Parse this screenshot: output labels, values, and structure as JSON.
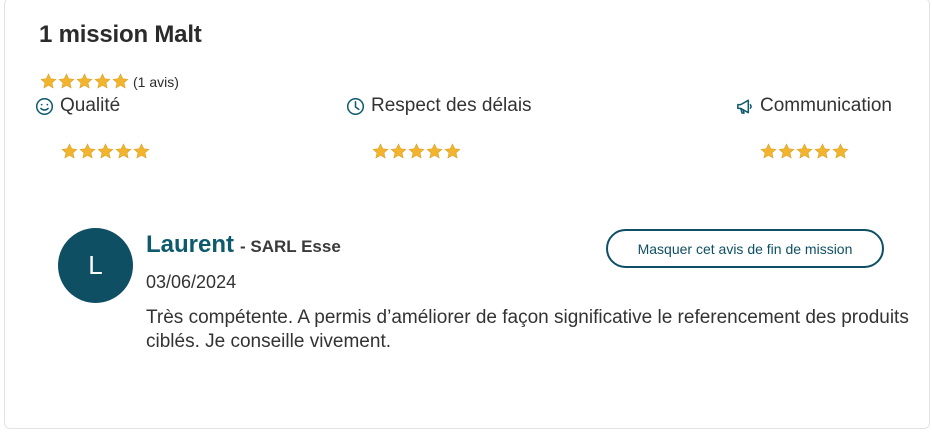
{
  "header": {
    "title": "1 mission Malt"
  },
  "overall_rating": {
    "stars": 5,
    "max": 5,
    "count_label": "(1 avis)"
  },
  "criteria": [
    {
      "label": "Qualité",
      "icon": "smile-icon",
      "stars": 5
    },
    {
      "label": "Respect des délais",
      "icon": "clock-icon",
      "stars": 5
    },
    {
      "label": "Communication",
      "icon": "megaphone-icon",
      "stars": 5
    }
  ],
  "review": {
    "avatar_initial": "L",
    "name": "Laurent",
    "company": "- SARL Esse",
    "date": "03/06/2024",
    "text": "Très compétente. A permis d’améliorer de façon significative le referencement des produits ciblés. Je conseille vivement.",
    "hide_button_label": "Masquer cet avis de fin de mission"
  },
  "colors": {
    "star": "#f2b42d",
    "accent": "#0e4f63"
  }
}
